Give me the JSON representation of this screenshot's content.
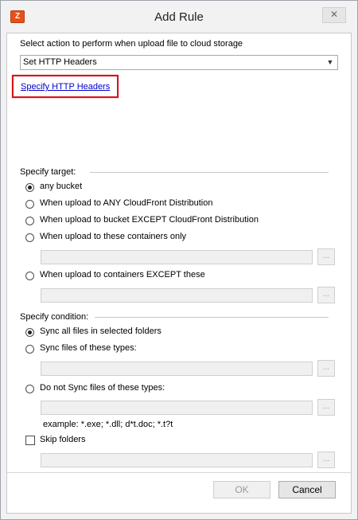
{
  "window": {
    "title": "Add Rule",
    "close_glyph": "✕",
    "app_icon_letter": "Z",
    "app_icon_name": "app-icon"
  },
  "action": {
    "prompt": "Select action to perform when upload file to cloud storage",
    "selected": "Set HTTP Headers",
    "link": "Specify HTTP Headers"
  },
  "target": {
    "label": "Specify target:",
    "options": [
      "any bucket",
      "When upload to ANY CloudFront Distribution",
      "When upload to bucket EXCEPT CloudFront Distribution",
      "When upload to these containers only",
      "When upload to containers EXCEPT these"
    ],
    "selected_index": 0
  },
  "condition": {
    "label": "Specify condition:",
    "options": [
      "Sync all files in selected folders",
      "Sync files of these types:",
      "Do not Sync files of these types:"
    ],
    "selected_index": 0,
    "example": "example: *.exe; *.dll; d*t.doc; *.t?t",
    "skip_folders": "Skip folders",
    "skip_folders_checked": false
  },
  "browse_label": "...",
  "buttons": {
    "ok": "OK",
    "cancel": "Cancel"
  },
  "colors": {
    "highlight": "#d9121b",
    "link": "#0000cc",
    "icon": "#e8501b"
  }
}
